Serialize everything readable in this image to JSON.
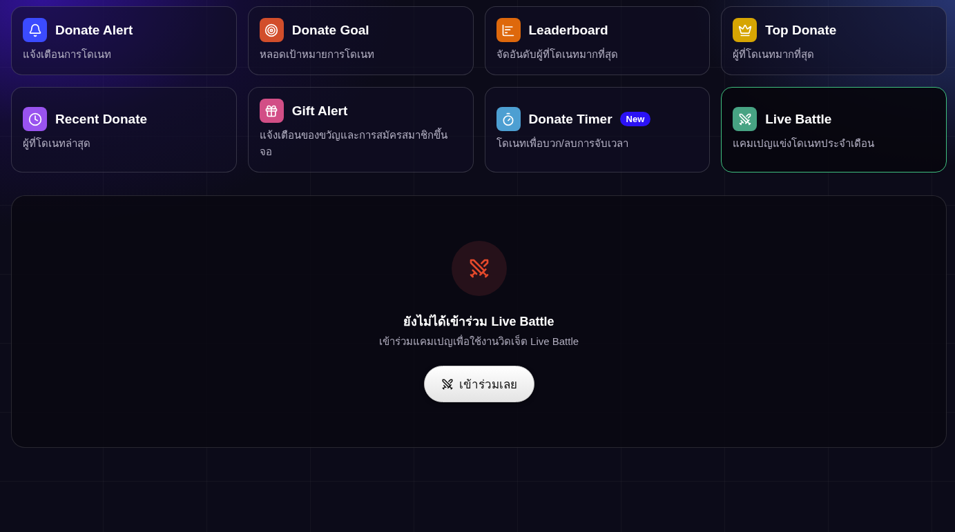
{
  "widgets": [
    {
      "kind": "alert",
      "title": "Donate Alert",
      "description": "แจ้งเตือนการโดเนท",
      "color": "#3b4bff",
      "selected": false
    },
    {
      "kind": "goal",
      "title": "Donate Goal",
      "description": "หลอดเป้าหมายการโดเนท",
      "color": "#d24e2b",
      "selected": false
    },
    {
      "kind": "leaderboard",
      "title": "Leaderboard",
      "description": "จัดอันดับผู้ที่โดเนทมากที่สุด",
      "color": "#de680c",
      "selected": false
    },
    {
      "kind": "top",
      "title": "Top Donate",
      "description": "ผู้ที่โดเนทมากที่สุด",
      "color": "#d6a503",
      "selected": false
    },
    {
      "kind": "recent",
      "title": "Recent Donate",
      "description": "ผู้ที่โดเนทล่าสุด",
      "color": "#9953ef",
      "selected": false
    },
    {
      "kind": "gift",
      "title": "Gift Alert",
      "description": "แจ้งเตือนของขวัญและการสมัครสมาชิกขึ้นจอ",
      "color": "#d24e86",
      "selected": false
    },
    {
      "kind": "timer",
      "title": "Donate Timer",
      "badge": "New",
      "description": "โดเนทเพื่อบวก/ลบการจับเวลา",
      "color": "#4d9fd2",
      "selected": false
    },
    {
      "kind": "battle",
      "title": "Live Battle",
      "description": "แคมเปญแข่งโดเนทประจำเดือน",
      "color": "#47a383",
      "selected": true
    }
  ],
  "battle_panel": {
    "title": "ยังไม่ได้เข้าร่วม Live Battle",
    "subtitle": "เข้าร่วมแคมเปญเพื่อใช้งานวิดเจ็ต Live Battle",
    "button": "เข้าร่วมเลย"
  }
}
